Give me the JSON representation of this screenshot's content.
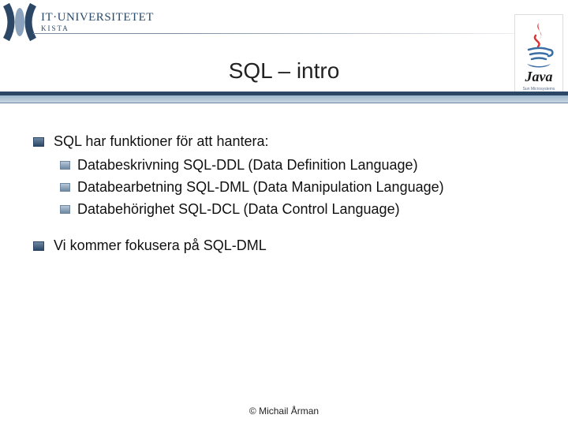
{
  "header": {
    "institution_line1": "IT·UNIVERSITETET",
    "institution_line2": "KISTA"
  },
  "java_logo": {
    "wordmark": "Java",
    "subtext": "Sun Microsystems"
  },
  "title": "SQL – intro",
  "bullets": {
    "b1": {
      "text": "SQL har funktioner för att hantera:",
      "sub": [
        "Databeskrivning SQL-DDL (Data Definition Language)",
        "Databearbetning SQL-DML (Data Manipulation Language)",
        "Databehörighet SQL-DCL (Data Control Language)"
      ]
    },
    "b2": {
      "text": "Vi kommer fokusera på SQL-DML"
    }
  },
  "footer": "© Michail Årman"
}
